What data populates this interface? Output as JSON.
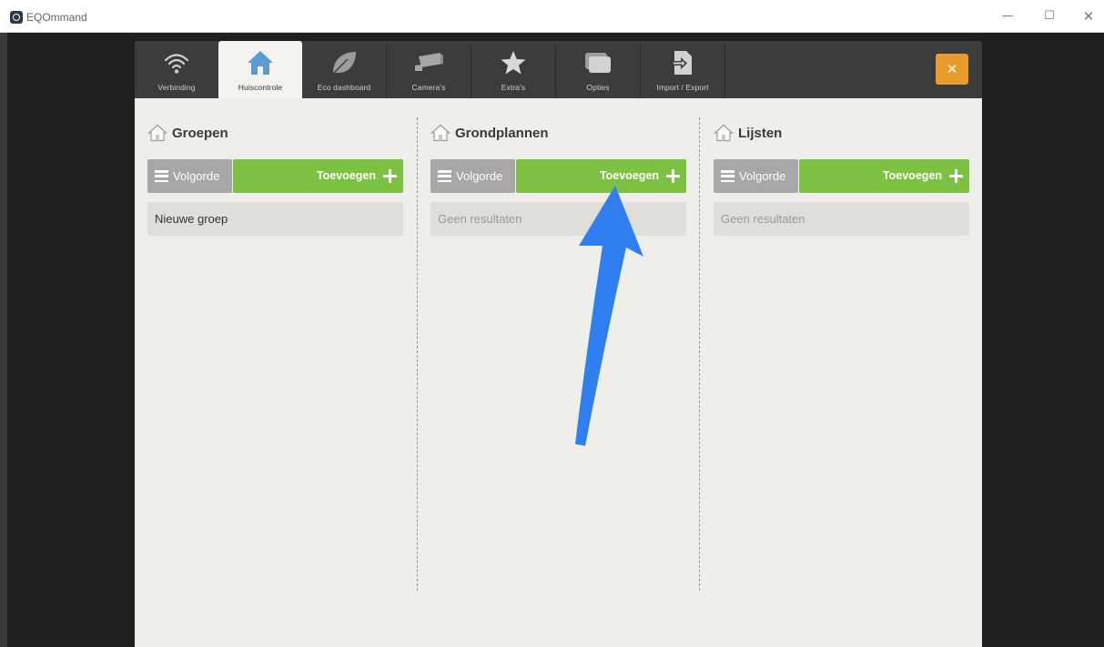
{
  "window": {
    "title": "EQOmmand",
    "minimize_glyph": "—",
    "maximize_glyph": "☐",
    "close_glyph": "✕"
  },
  "tabs": [
    {
      "label": "Verbinding",
      "icon": "wifi-icon"
    },
    {
      "label": "Huiscontrole",
      "icon": "house-icon",
      "active": true
    },
    {
      "label": "Eco dashboard",
      "icon": "leaf-icon"
    },
    {
      "label": "Camera's",
      "icon": "camera-icon"
    },
    {
      "label": "Extra's",
      "icon": "star-icon"
    },
    {
      "label": "Opties",
      "icon": "windows-icon"
    },
    {
      "label": "Import / Export",
      "icon": "import-export-icon"
    }
  ],
  "close_button": {
    "glyph": "✕",
    "color": "#e89b2a"
  },
  "columns": [
    {
      "title": "Groepen",
      "order_label": "Volgorde",
      "add_label": "Toevoegen",
      "rows": [
        {
          "text": "Nieuwe groep",
          "empty": false
        }
      ]
    },
    {
      "title": "Grondplannen",
      "order_label": "Volgorde",
      "add_label": "Toevoegen",
      "rows": [
        {
          "text": "Geen resultaten",
          "empty": true
        }
      ]
    },
    {
      "title": "Lijsten",
      "order_label": "Volgorde",
      "add_label": "Toevoegen",
      "rows": [
        {
          "text": "Geen resultaten",
          "empty": true
        }
      ]
    }
  ],
  "colors": {
    "add_green": "#7cc142",
    "order_gray": "#a7a7a7",
    "topbar": "#3c3c3c",
    "accent_orange": "#e89b2a",
    "annotation_arrow": "#2f7ff0"
  }
}
